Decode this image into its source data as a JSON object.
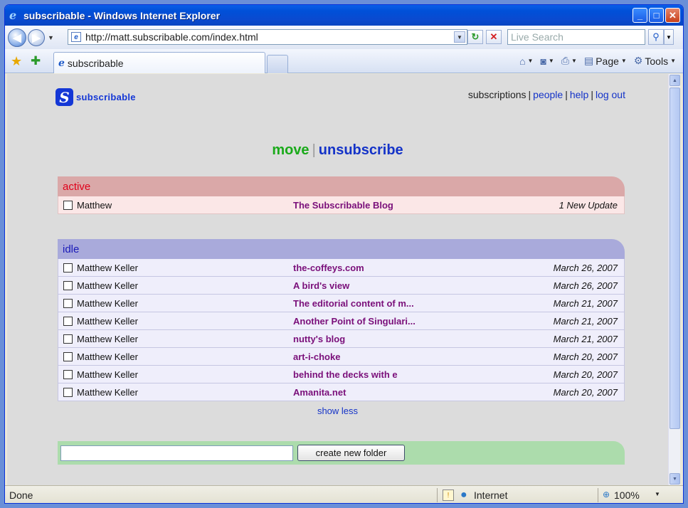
{
  "window": {
    "title": "subscribable - Windows Internet Explorer",
    "controls": {
      "minimize": "_",
      "maximize": "□",
      "close": "✕"
    }
  },
  "toolbar": {
    "address": "http://matt.subscribable.com/index.html",
    "search_placeholder": "Live Search",
    "tab_title": "subscribable",
    "page_label": "Page",
    "tools_label": "Tools"
  },
  "site": {
    "logo_text": "subscribable",
    "nav": {
      "subscriptions": "subscriptions",
      "people": "people",
      "help": "help",
      "logout": "log out"
    },
    "actions": {
      "move": "move",
      "separator": "|",
      "unsubscribe": "unsubscribe"
    }
  },
  "groups": {
    "active": {
      "title": "active",
      "rows": [
        {
          "owner": "Matthew",
          "feed": "The Subscribable Blog",
          "date": "1 New Update"
        }
      ]
    },
    "idle": {
      "title": "idle",
      "rows": [
        {
          "owner": "Matthew Keller",
          "feed": "the-coffeys.com",
          "date": "March 26, 2007"
        },
        {
          "owner": "Matthew Keller",
          "feed": "A bird's view",
          "date": "March 26, 2007"
        },
        {
          "owner": "Matthew Keller",
          "feed": "The editorial content of m...",
          "date": "March 21, 2007"
        },
        {
          "owner": "Matthew Keller",
          "feed": "Another Point of Singulari...",
          "date": "March 21, 2007"
        },
        {
          "owner": "Matthew Keller",
          "feed": "nutty's blog",
          "date": "March 21, 2007"
        },
        {
          "owner": "Matthew Keller",
          "feed": "art-i-choke",
          "date": "March 20, 2007"
        },
        {
          "owner": "Matthew Keller",
          "feed": "behind the decks with e",
          "date": "March 20, 2007"
        },
        {
          "owner": "Matthew Keller",
          "feed": "Amanita.net",
          "date": "March 20, 2007"
        }
      ]
    }
  },
  "show_less": "show less",
  "new_folder": {
    "input_value": "",
    "button_label": "create new folder"
  },
  "statusbar": {
    "status": "Done",
    "zone": "Internet",
    "zoom": "100%"
  },
  "colors": {
    "active_header": "#daa8a8",
    "idle_header": "#a9aadb",
    "feed_link": "#7a0f7a",
    "brand_blue": "#1437d6"
  }
}
